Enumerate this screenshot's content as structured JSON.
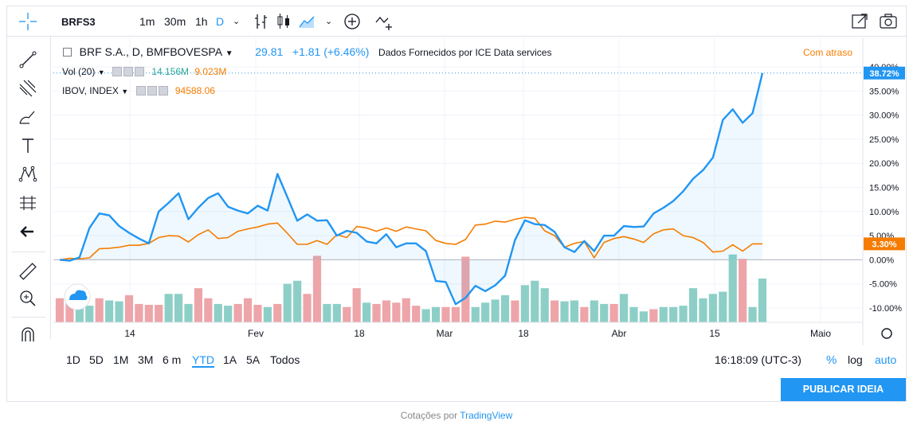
{
  "toolbar": {
    "symbol": "BRFS3",
    "intervals": [
      "1m",
      "30m",
      "1h",
      "D"
    ],
    "active_interval": "D"
  },
  "legend": {
    "main_label": "BRF S.A., D, BMFBOVESPA",
    "price": "29.81",
    "change": "+1.81 (+6.46%)",
    "provider": "Dados Fornecidos por ICE Data services",
    "delay": "Com atraso",
    "vol_label": "Vol (20)",
    "vol_value_1": "14.156M",
    "vol_value_2": "9.023M",
    "ibov_label": "IBOV, INDEX",
    "ibov_value": "94588.06"
  },
  "bottom": {
    "periods": [
      "1D",
      "5D",
      "1M",
      "3M",
      "6 m",
      "YTD",
      "1A",
      "5A",
      "Todos"
    ],
    "active_period": "YTD",
    "time": "16:18:09 (UTC-3)",
    "pct": "%",
    "log": "log",
    "auto": "auto"
  },
  "publish_label": "PUBLICAR IDEIA",
  "footer": {
    "prefix": "Cotações por",
    "brand": "TradingView"
  },
  "colors": {
    "main": "#2196f3",
    "ibov": "#f57c00",
    "vol_up": "#8dcfc7",
    "vol_down": "#eda5a9",
    "grid": "#f0f3fa"
  },
  "chart_data": {
    "type": "line",
    "x_tick_labels": [
      "14",
      "Fev",
      "18",
      "Mar",
      "18",
      "Abr",
      "15",
      "Maio"
    ],
    "y_tick_labels": [
      "40.00%",
      "35.00%",
      "30.00%",
      "25.00%",
      "20.00%",
      "15.00%",
      "10.00%",
      "5.00%",
      "0.00%",
      "-5.00%",
      "-10.00%"
    ],
    "ylim": [
      -12,
      41
    ],
    "last_labels": {
      "main": "38.72%",
      "ibov": "3.30%"
    },
    "series": [
      {
        "name": "BRF S.A., D, BMFBOVESPA",
        "values": [
          0,
          -0.2,
          0.5,
          6.6,
          9.6,
          9.2,
          7,
          5.6,
          4.4,
          3.4,
          10,
          11.8,
          13.8,
          8.4,
          10.8,
          12.8,
          13.8,
          11,
          10.2,
          9.6,
          11.2,
          10.2,
          17.8,
          13,
          8.1,
          9.4,
          8.1,
          8.2,
          5,
          6,
          5.6,
          3.8,
          3.4,
          5.3,
          2.6,
          3.4,
          3.4,
          1.8,
          -4.4,
          -4.6,
          -9.2,
          -7.9,
          -5.4,
          -6.5,
          -5.3,
          -3.3,
          4.1,
          8.2,
          7.4,
          7.2,
          5.8,
          2.6,
          1.6,
          3.9,
          1.8,
          5,
          5,
          7,
          6.8,
          6.9,
          9.6,
          10.8,
          12.2,
          14.2,
          16.8,
          18.6,
          21.2,
          29,
          31.2,
          28.4,
          30.4,
          38.72
        ]
      },
      {
        "name": "IBOV, INDEX",
        "values": [
          0,
          0.3,
          0.2,
          0.4,
          2.3,
          2.4,
          2.6,
          3,
          3,
          3.4,
          4.6,
          5,
          4.9,
          3.7,
          5.2,
          6.2,
          4.4,
          4.6,
          5.9,
          6.4,
          6.8,
          7.4,
          7.6,
          5.5,
          3.2,
          3.2,
          4,
          3.2,
          5.2,
          4.6,
          6.9,
          6.6,
          5.9,
          6.6,
          5.9,
          6.8,
          6.4,
          6,
          4,
          3.4,
          3.2,
          4.2,
          7.2,
          7.4,
          8,
          7.8,
          8.4,
          8.8,
          8.6,
          6,
          5,
          2.6,
          3.4,
          3.8,
          0.4,
          3.6,
          4.4,
          4.8,
          4.3,
          3.6,
          5.4,
          6.2,
          6.4,
          5,
          4.6,
          3.6,
          1.6,
          1.8,
          3.1,
          1.8,
          3.3,
          3.3
        ]
      }
    ],
    "volume_bars": [
      {
        "v": 0.55,
        "up": false
      },
      {
        "v": 0.5,
        "up": false
      },
      {
        "v": 0.42,
        "up": true
      },
      {
        "v": 0.38,
        "up": true
      },
      {
        "v": 0.55,
        "up": false
      },
      {
        "v": 0.5,
        "up": true
      },
      {
        "v": 0.48,
        "up": true
      },
      {
        "v": 0.62,
        "up": false
      },
      {
        "v": 0.42,
        "up": false
      },
      {
        "v": 0.4,
        "up": false
      },
      {
        "v": 0.4,
        "up": false
      },
      {
        "v": 0.65,
        "up": true
      },
      {
        "v": 0.65,
        "up": true
      },
      {
        "v": 0.42,
        "up": true
      },
      {
        "v": 0.78,
        "up": false
      },
      {
        "v": 0.55,
        "up": false
      },
      {
        "v": 0.42,
        "up": true
      },
      {
        "v": 0.38,
        "up": true
      },
      {
        "v": 0.42,
        "up": false
      },
      {
        "v": 0.55,
        "up": false
      },
      {
        "v": 0.4,
        "up": false
      },
      {
        "v": 0.35,
        "up": true
      },
      {
        "v": 0.42,
        "up": false
      },
      {
        "v": 0.88,
        "up": true
      },
      {
        "v": 0.95,
        "up": true
      },
      {
        "v": 0.65,
        "up": false
      },
      {
        "v": 1.52,
        "up": false
      },
      {
        "v": 0.42,
        "up": true
      },
      {
        "v": 0.42,
        "up": true
      },
      {
        "v": 0.35,
        "up": false
      },
      {
        "v": 0.78,
        "up": false
      },
      {
        "v": 0.45,
        "up": true
      },
      {
        "v": 0.42,
        "up": false
      },
      {
        "v": 0.5,
        "up": false
      },
      {
        "v": 0.45,
        "up": false
      },
      {
        "v": 0.55,
        "up": false
      },
      {
        "v": 0.38,
        "up": false
      },
      {
        "v": 0.3,
        "up": true
      },
      {
        "v": 0.35,
        "up": true
      },
      {
        "v": 0.35,
        "up": false
      },
      {
        "v": 0.35,
        "up": false
      },
      {
        "v": 1.5,
        "up": false
      },
      {
        "v": 0.35,
        "up": true
      },
      {
        "v": 0.45,
        "up": true
      },
      {
        "v": 0.52,
        "up": true
      },
      {
        "v": 0.62,
        "up": true
      },
      {
        "v": 0.5,
        "up": false
      },
      {
        "v": 0.85,
        "up": true
      },
      {
        "v": 0.95,
        "up": true
      },
      {
        "v": 0.78,
        "up": true
      },
      {
        "v": 0.5,
        "up": false
      },
      {
        "v": 0.48,
        "up": true
      },
      {
        "v": 0.5,
        "up": true
      },
      {
        "v": 0.35,
        "up": false
      },
      {
        "v": 0.5,
        "up": true
      },
      {
        "v": 0.42,
        "up": true
      },
      {
        "v": 0.42,
        "up": false
      },
      {
        "v": 0.65,
        "up": true
      },
      {
        "v": 0.35,
        "up": true
      },
      {
        "v": 0.25,
        "up": true
      },
      {
        "v": 0.3,
        "up": false
      },
      {
        "v": 0.35,
        "up": true
      },
      {
        "v": 0.35,
        "up": true
      },
      {
        "v": 0.38,
        "up": true
      },
      {
        "v": 0.78,
        "up": true
      },
      {
        "v": 0.55,
        "up": true
      },
      {
        "v": 0.65,
        "up": true
      },
      {
        "v": 0.7,
        "up": true
      },
      {
        "v": 1.55,
        "up": true
      },
      {
        "v": 1.45,
        "up": false
      },
      {
        "v": 0.35,
        "up": true
      },
      {
        "v": 1.0,
        "up": true
      }
    ]
  }
}
